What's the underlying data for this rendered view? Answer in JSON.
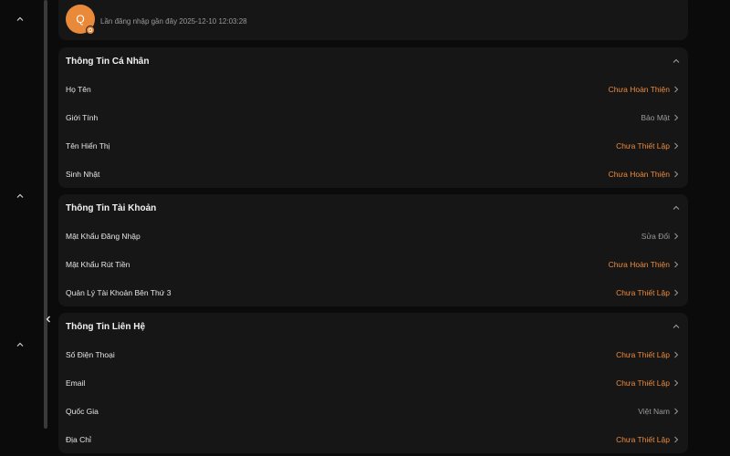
{
  "profile": {
    "avatar_initial": "Q",
    "last_login": "Lần đăng nhập gần đây 2025-12-10 12:03:28"
  },
  "sections": [
    {
      "title": "Thông Tin Cá Nhân",
      "rows": [
        {
          "label": "Họ Tên",
          "value": "Chưa Hoàn Thiện",
          "status": "orange"
        },
        {
          "label": "Giới Tính",
          "value": "Bảo Mật",
          "status": "gray"
        },
        {
          "label": "Tên Hiển Thị",
          "value": "Chưa Thiết Lập",
          "status": "orange"
        },
        {
          "label": "Sinh Nhật",
          "value": "Chưa Hoàn Thiện",
          "status": "orange"
        }
      ]
    },
    {
      "title": "Thông Tin Tài Khoản",
      "rows": [
        {
          "label": "Mật Khẩu Đăng Nhập",
          "value": "Sửa Đổi",
          "status": "gray"
        },
        {
          "label": "Mật Khẩu Rút Tiền",
          "value": "Chưa Hoàn Thiện",
          "status": "orange"
        },
        {
          "label": "Quản Lý Tài Khoản Bên Thứ 3",
          "value": "Chưa Thiết Lập",
          "status": "orange"
        }
      ]
    },
    {
      "title": "Thông Tin Liên Hệ",
      "rows": [
        {
          "label": "Số Điện Thoại",
          "value": "Chưa Thiết Lập",
          "status": "orange"
        },
        {
          "label": "Email",
          "value": "Chưa Thiết Lập",
          "status": "orange"
        },
        {
          "label": "Quốc Gia",
          "value": "Việt Nam",
          "status": "gray"
        },
        {
          "label": "Địa Chỉ",
          "value": "Chưa Thiết Lập",
          "status": "orange"
        }
      ]
    }
  ],
  "colors": {
    "accent": "#ee8a3c",
    "muted": "#9a9a9a",
    "card": "#161616",
    "background": "#0b0b0b"
  },
  "icons": {
    "sidebar": "chevron-up-icon",
    "collapse": "chevron-left-icon",
    "section_toggle": "chevron-up-icon",
    "row_arrow": "chevron-right-icon"
  }
}
